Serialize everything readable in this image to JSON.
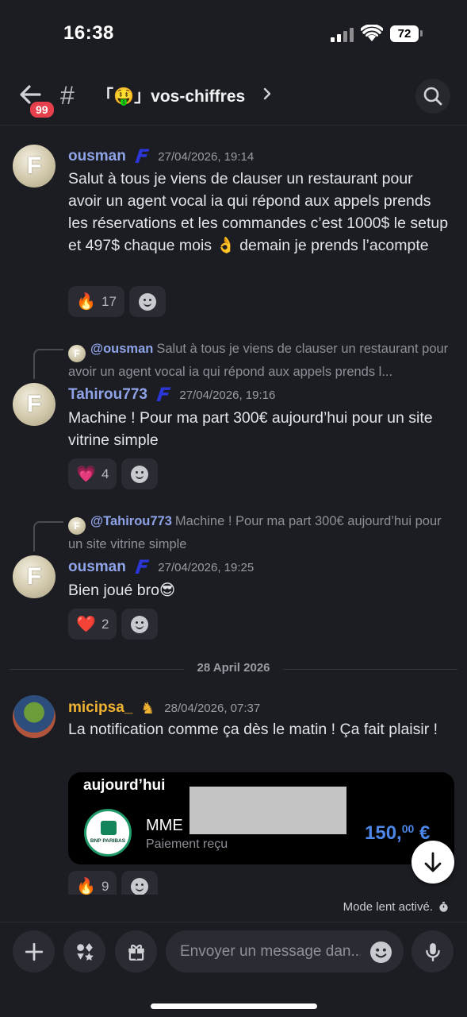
{
  "status_bar": {
    "time": "16:38",
    "battery": "72"
  },
  "header": {
    "back_badge": "99",
    "channel_name": "「🤑」vos-chiffres"
  },
  "messages": [
    {
      "author": "ousman",
      "tag": "F",
      "timestamp": "27/04/2026, 19:14",
      "text": "Salut à tous je viens de clauser un restaurant pour avoir un agent vocal ia qui répond aux appels prends les réservations et les commandes c’est 1000$ le setup et 497$ chaque mois 👌 demain je prends l’acompte",
      "reactions": [
        {
          "emoji": "🔥",
          "count": "17"
        }
      ]
    },
    {
      "reply_to": {
        "mention": "@ousman",
        "text": "Salut à tous je viens de clauser un restaurant pour avoir un agent vocal ia qui répond aux appels prends l..."
      },
      "author": "Tahirou773",
      "tag": "F",
      "timestamp": "27/04/2026, 19:16",
      "text": "Machine ! Pour ma part 300€ aujourd’hui pour un site vitrine simple",
      "reactions": [
        {
          "emoji": "💗",
          "count": "4"
        }
      ]
    },
    {
      "reply_to": {
        "mention": "@Tahirou773",
        "text": "Machine ! Pour ma part 300€ aujourd’hui pour un site vitrine simple"
      },
      "author": "ousman",
      "tag": "F",
      "timestamp": "27/04/2026, 19:25",
      "text": "Bien joué bro😎",
      "reactions": [
        {
          "emoji": "❤️",
          "count": "2"
        }
      ]
    },
    {
      "author": "micipsa_",
      "timestamp": "28/04/2026, 07:37",
      "text": "La notification comme ça dès le matin ! Ça fait plaisir !",
      "embed": {
        "heading": "aujourd’hui",
        "bank": "BNP PARIBAS",
        "payee": "MME",
        "status": "Paiement reçu",
        "amount_main": "150,",
        "amount_cents": "00",
        "amount_currency": "€"
      },
      "reactions": [
        {
          "emoji": "🔥",
          "count": "9"
        }
      ]
    }
  ],
  "date_divider": "28 April 2026",
  "slowmode": "Mode lent activé.",
  "composer": {
    "placeholder": "Envoyer un message dan..."
  },
  "colors": {
    "background": "#1c1d22",
    "username": "#8fa3e8",
    "gold_username": "#f0b232",
    "amount": "#4b86e8",
    "badge": "#e5404b"
  }
}
